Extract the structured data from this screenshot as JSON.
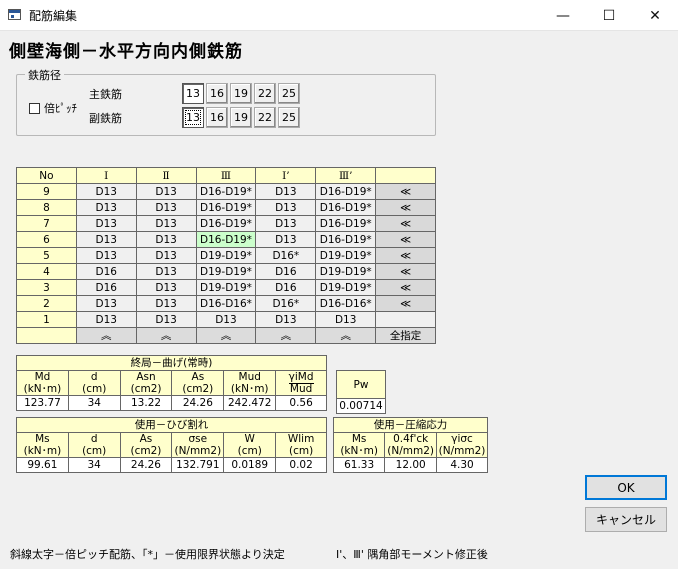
{
  "window": {
    "title": "配筋編集",
    "minimize": "—",
    "maximize": "☐",
    "close": "✕"
  },
  "heading": "側壁海側－水平方向内側鉄筋",
  "rebar_group": {
    "legend": "鉄筋径",
    "double_pitch_label": "倍ﾋﾟｯﾁ",
    "main_label": "主鉄筋",
    "sub_label": "副鉄筋",
    "main_sizes": [
      "13",
      "16",
      "19",
      "22",
      "25"
    ],
    "sub_sizes": [
      "13",
      "16",
      "19",
      "22",
      "25"
    ]
  },
  "grid": {
    "headers": [
      "No",
      "Ⅰ",
      "Ⅱ",
      "Ⅲ",
      "Ⅰ’",
      "Ⅲ’",
      ""
    ],
    "rows": [
      {
        "no": "9",
        "cells": [
          "D13",
          "D13",
          "D16-D19*",
          "D13",
          "D16-D19*"
        ],
        "action": "≪"
      },
      {
        "no": "8",
        "cells": [
          "D13",
          "D13",
          "D16-D19*",
          "D13",
          "D16-D19*"
        ],
        "action": "≪"
      },
      {
        "no": "7",
        "cells": [
          "D13",
          "D13",
          "D16-D19*",
          "D13",
          "D16-D19*"
        ],
        "action": "≪"
      },
      {
        "no": "6",
        "cells": [
          "D13",
          "D13",
          "D16-D19*",
          "D13",
          "D16-D19*"
        ],
        "action": "≪"
      },
      {
        "no": "5",
        "cells": [
          "D13",
          "D13",
          "D19-D19*",
          "D16*",
          "D19-D19*"
        ],
        "action": "≪"
      },
      {
        "no": "4",
        "cells": [
          "D16",
          "D13",
          "D19-D19*",
          "D16",
          "D19-D19*"
        ],
        "action": "≪"
      },
      {
        "no": "3",
        "cells": [
          "D16",
          "D13",
          "D19-D19*",
          "D16",
          "D19-D19*"
        ],
        "action": "≪"
      },
      {
        "no": "2",
        "cells": [
          "D13",
          "D13",
          "D16-D16*",
          "D16*",
          "D16-D16*"
        ],
        "action": "≪"
      },
      {
        "no": "1",
        "cells": [
          "D13",
          "D13",
          "D13",
          "D13",
          "D13"
        ],
        "action": ""
      }
    ],
    "col_arrows": [
      "︽",
      "︽",
      "︽",
      "︽",
      "︽"
    ],
    "all_label": "全指定"
  },
  "bending": {
    "title": "終局－曲げ(常時)",
    "cols": [
      {
        "h1": "Md",
        "h2": "(kN･m)",
        "val": "123.77"
      },
      {
        "h1": "d",
        "h2": "(cm)",
        "val": "34"
      },
      {
        "h1": "Asn",
        "h2": "(cm2)",
        "val": "13.22"
      },
      {
        "h1": "As",
        "h2": "(cm2)",
        "val": "24.26"
      },
      {
        "h1": "Mud",
        "h2": "(kN･m)",
        "val": "242.472"
      },
      {
        "h1": "γiMd",
        "h2": "Mud",
        "val": "0.56"
      }
    ]
  },
  "pw": {
    "label": "Pw",
    "val": "0.00714"
  },
  "crack": {
    "title": "使用－ひび割れ",
    "cols": [
      {
        "h1": "Ms",
        "h2": "(kN･m)",
        "val": "99.61"
      },
      {
        "h1": "d",
        "h2": "(cm)",
        "val": "34"
      },
      {
        "h1": "As",
        "h2": "(cm2)",
        "val": "24.26"
      },
      {
        "h1": "σse",
        "h2": "(N/mm2)",
        "val": "132.791"
      },
      {
        "h1": "W",
        "h2": "(cm)",
        "val": "0.0189"
      },
      {
        "h1": "Wlim",
        "h2": "(cm)",
        "val": "0.02"
      }
    ]
  },
  "compress": {
    "title": "使用－圧縮応力",
    "cols": [
      {
        "h1": "Ms",
        "h2": "(kN･m)",
        "val": "61.33"
      },
      {
        "h1": "0.4f'ck",
        "h2": "(N/mm2)",
        "val": "12.00"
      },
      {
        "h1": "γiσc",
        "h2": "(N/mm2)",
        "val": "4.30"
      }
    ]
  },
  "buttons": {
    "ok": "OK",
    "cancel": "キャンセル"
  },
  "footnotes": {
    "left": "斜線太字－倍ピッチ配筋、「*」－使用限界状態より決定",
    "right": "Ⅰ'、Ⅲ' 隅角部モーメント修正後"
  }
}
